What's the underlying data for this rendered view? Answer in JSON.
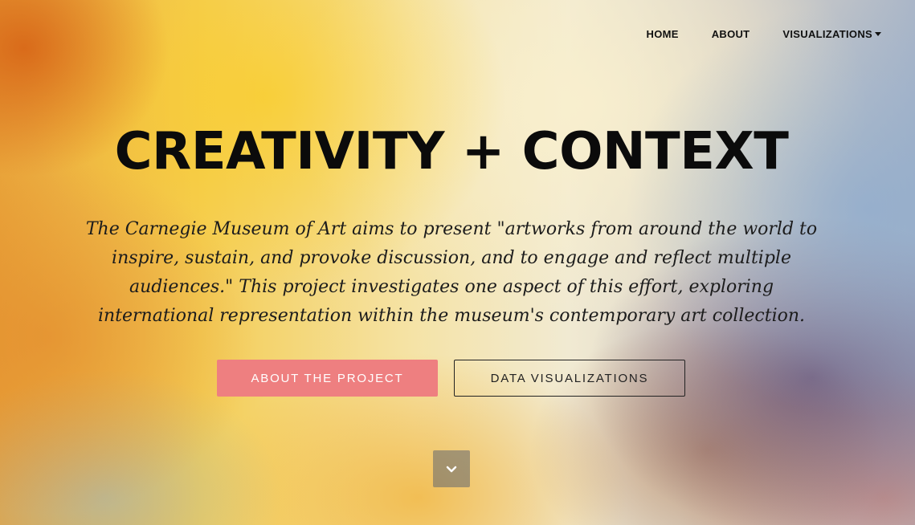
{
  "nav": {
    "items": [
      {
        "label": "HOME"
      },
      {
        "label": "ABOUT"
      },
      {
        "label": "VISUALIZATIONS",
        "has_dropdown": true
      }
    ]
  },
  "hero": {
    "title": "CREATIVITY + CONTEXT",
    "description": "The Carnegie Museum of Art aims to present \"artworks from around the world to inspire, sustain, and provoke discussion, and to engage and reflect multiple audiences.\" This project investigates one aspect of this effort, exploring international representation within the museum's contemporary art collection.",
    "primary_button": "ABOUT THE PROJECT",
    "secondary_button": "DATA VISUALIZATIONS",
    "scroll_icon": "chevron-down-icon"
  },
  "colors": {
    "primary_button_bg": "#ee7f80",
    "text": "#0b0b0b"
  }
}
